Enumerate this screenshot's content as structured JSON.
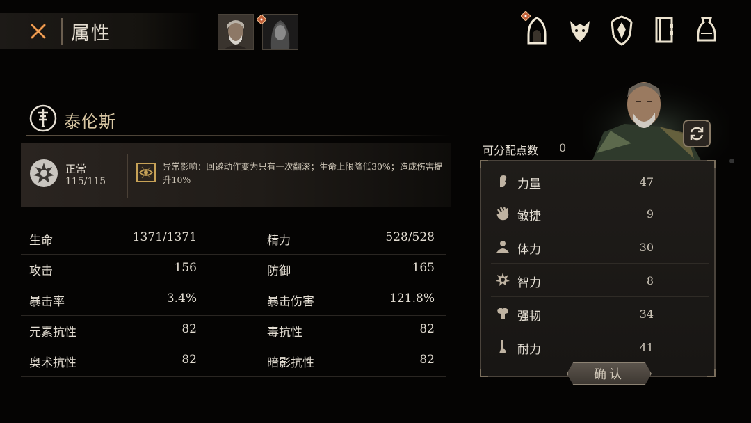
{
  "header": {
    "title": "属性"
  },
  "character": {
    "name": "泰伦斯"
  },
  "status": {
    "name": "正常",
    "value": "115/115",
    "effect_text": "异常影响：回避动作变为只有一次翻滚；生命上限降低30%；造成伤害提升10%"
  },
  "stats": [
    {
      "label": "生命",
      "value": "1371/1371"
    },
    {
      "label": "精力",
      "value": "528/528"
    },
    {
      "label": "攻击",
      "value": "156"
    },
    {
      "label": "防御",
      "value": "165"
    },
    {
      "label": "暴击率",
      "value": "3.4%"
    },
    {
      "label": "暴击伤害",
      "value": "121.8%"
    },
    {
      "label": "元素抗性",
      "value": "82"
    },
    {
      "label": "毒抗性",
      "value": "82"
    },
    {
      "label": "奥术抗性",
      "value": "82"
    },
    {
      "label": "暗影抗性",
      "value": "82"
    }
  ],
  "points": {
    "label": "可分配点数",
    "value": "0"
  },
  "attributes": [
    {
      "label": "力量",
      "value": "47",
      "icon": "strength-icon"
    },
    {
      "label": "敏捷",
      "value": "9",
      "icon": "agility-icon"
    },
    {
      "label": "体力",
      "value": "30",
      "icon": "vitality-icon"
    },
    {
      "label": "智力",
      "value": "8",
      "icon": "intelligence-icon"
    },
    {
      "label": "强韧",
      "value": "34",
      "icon": "toughness-icon"
    },
    {
      "label": "耐力",
      "value": "41",
      "icon": "endurance-icon"
    }
  ],
  "confirm_label": "确认",
  "colors": {
    "accent_orange": "#e2863a",
    "gold": "#d9c7a3",
    "panel": "#1f1c19"
  }
}
